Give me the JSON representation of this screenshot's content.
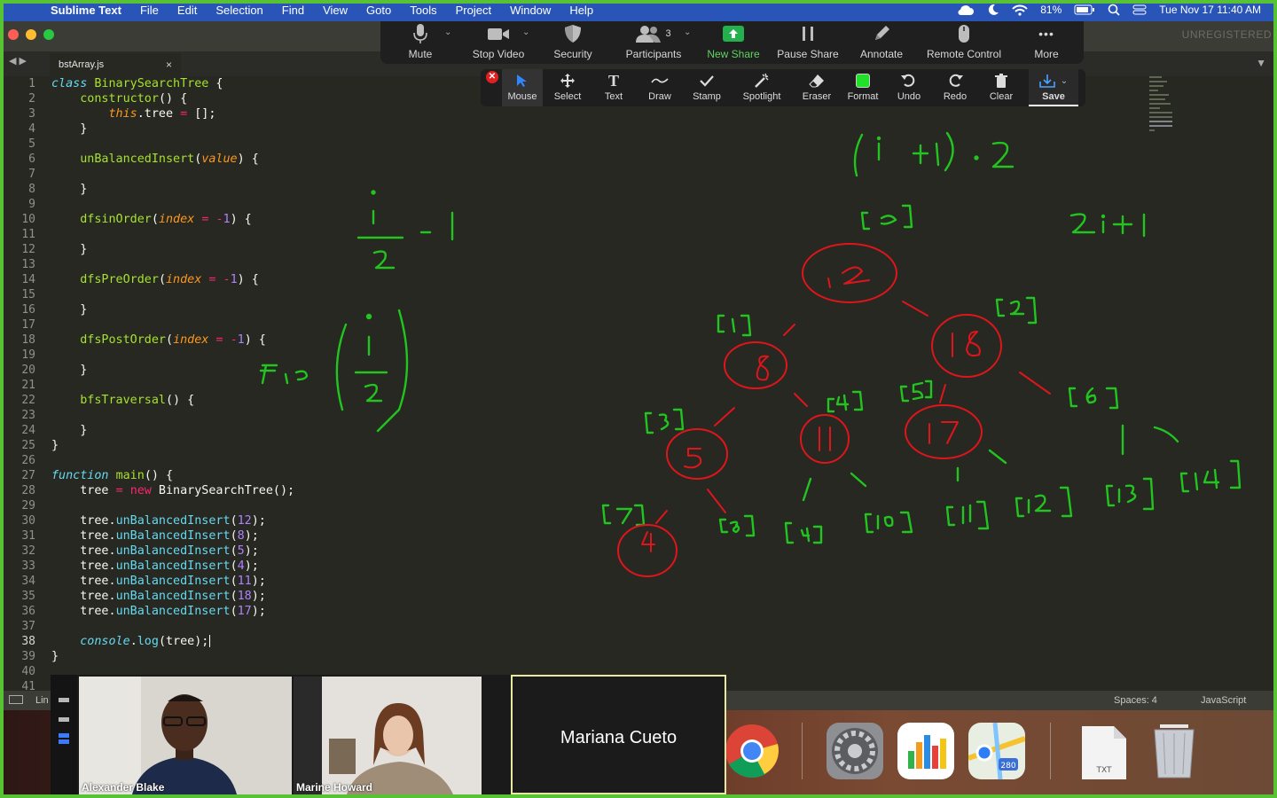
{
  "menubar": {
    "apple_glyph": "",
    "app_name": "Sublime Text",
    "menus": [
      "File",
      "Edit",
      "Selection",
      "Find",
      "View",
      "Goto",
      "Tools",
      "Project",
      "Window",
      "Help"
    ],
    "battery": "81%",
    "clock": "Tue Nov 17  11:40 AM"
  },
  "window": {
    "tab_label": "bstArray.js",
    "tab_close": "×",
    "unregistered": "UNREGISTERED",
    "nav_arrows": "◀ ▶",
    "dropdown": "▼"
  },
  "editor": {
    "current_line": 38,
    "line_count": 41
  },
  "zoom_toolbar": {
    "mute": "Mute",
    "stop_video": "Stop Video",
    "security": "Security",
    "participants": "Participants",
    "participants_count": "3",
    "new_share": "New Share",
    "pause_share": "Pause Share",
    "annotate": "Annotate",
    "remote_control": "Remote Control",
    "more": "More",
    "more_glyph": "•••",
    "caret": "⌄"
  },
  "annotation_toolbar": {
    "close": "✕",
    "mouse": "Mouse",
    "select": "Select",
    "text": "Text",
    "text_glyph": "T",
    "draw": "Draw",
    "stamp": "Stamp",
    "spotlight": "Spotlight",
    "eraser": "Eraser",
    "format": "Format",
    "undo": "Undo",
    "redo": "Redo",
    "clear": "Clear",
    "save": "Save",
    "save_caret": "⌄"
  },
  "status_bar": {
    "left": "Lin",
    "spaces": "Spaces: 4",
    "syntax": "JavaScript"
  },
  "zoom_participants": {
    "tile1_name": "Alexander Blake",
    "tile2_name": "Marine Howard",
    "active_speaker": "Mariana Cueto"
  },
  "dock": {
    "txt_label": "TXT",
    "maps_badge": "280"
  },
  "colors": {
    "annotation_green": "#22c41f",
    "annotation_red": "#e0151b",
    "frame_green": "#56c234",
    "menubar_blue": "#2a55b8"
  }
}
